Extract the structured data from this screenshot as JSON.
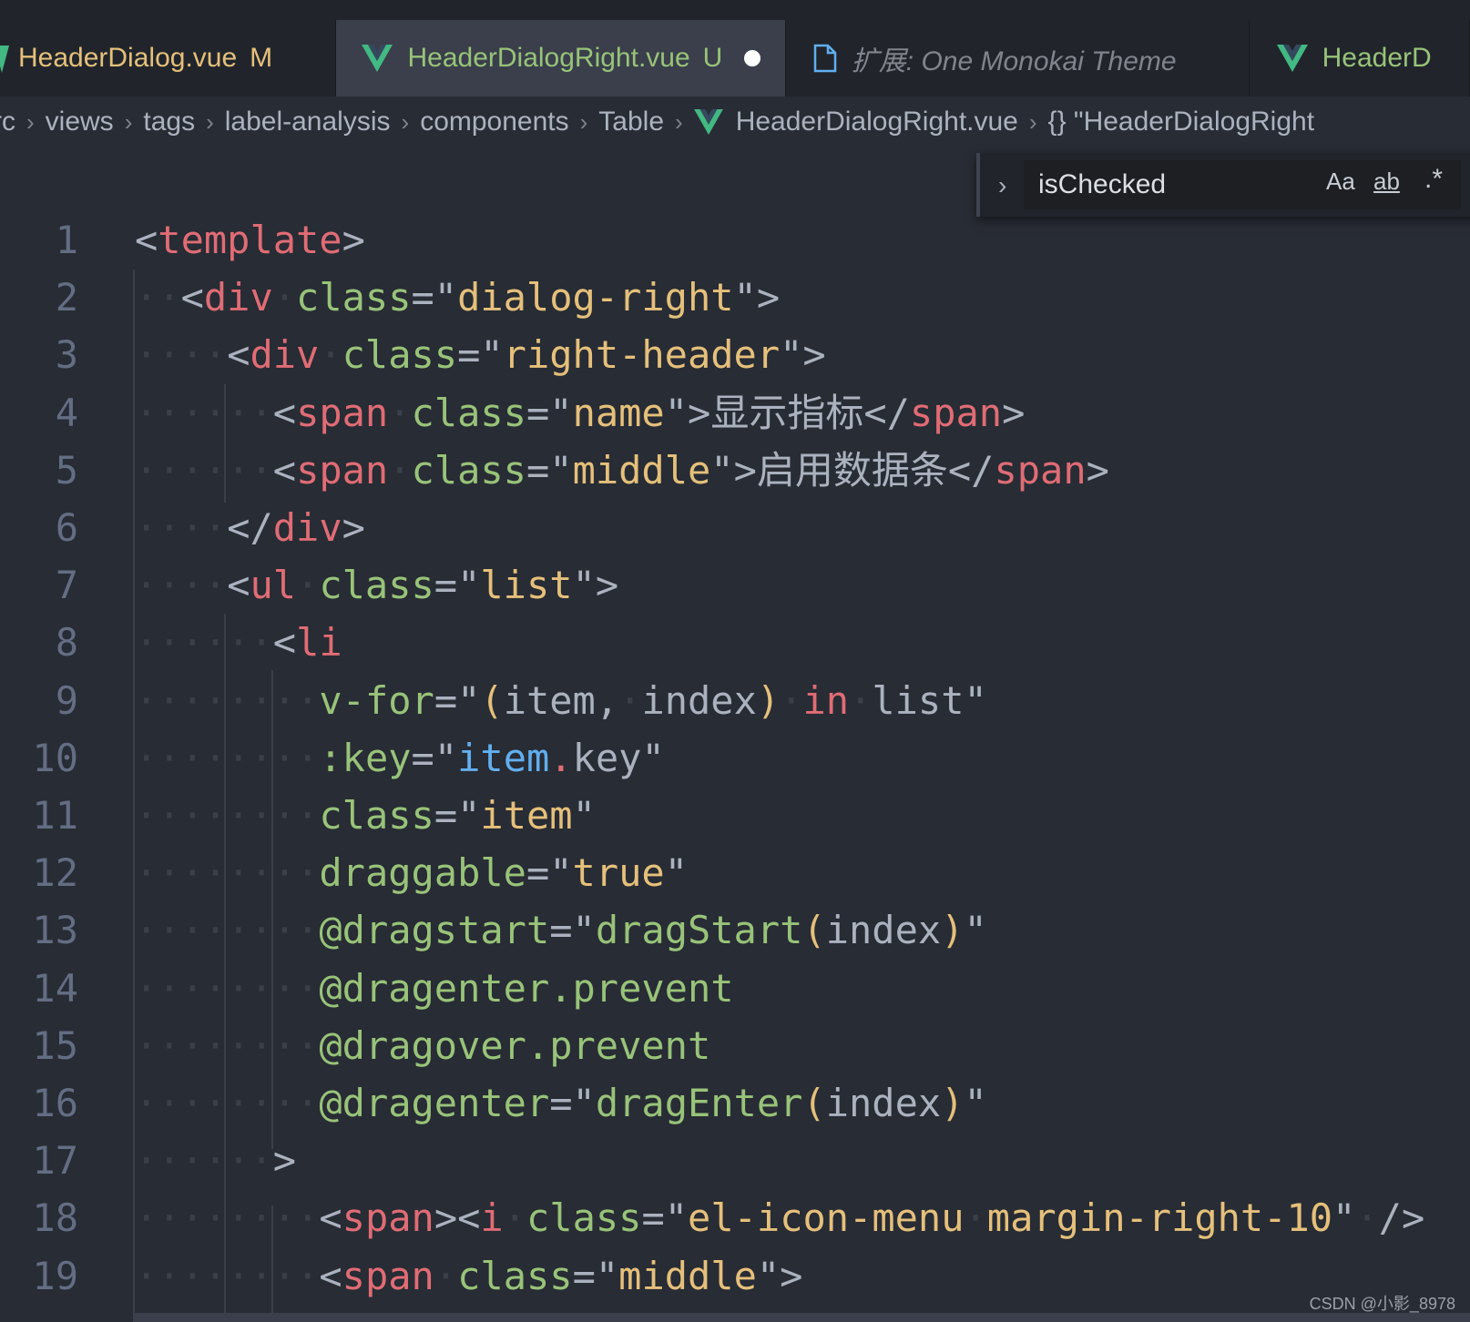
{
  "tabs": [
    {
      "label": "HeaderDialog.vue",
      "status": "M",
      "icon": "vue-icon"
    },
    {
      "label": "HeaderDialogRight.vue",
      "status": "U",
      "dirty": true,
      "icon": "vue-icon"
    },
    {
      "label": "扩展: One Monokai Theme",
      "icon": "file-icon"
    },
    {
      "label": "HeaderD",
      "icon": "vue-icon"
    }
  ],
  "breadcrumb": {
    "items": [
      "rc",
      "views",
      "tags",
      "label-analysis",
      "components",
      "Table",
      "HeaderDialogRight.vue",
      "{} \"HeaderDialogRight"
    ]
  },
  "find": {
    "query": "isChecked",
    "case_label": "Aa",
    "word_label": "ab",
    "regex_label": ".*"
  },
  "editor": {
    "lines": [
      {
        "n": "1",
        "text": "<template>"
      },
      {
        "n": "2",
        "text": "··<div·class=\"dialog-right\">"
      },
      {
        "n": "3",
        "text": "····<div·class=\"right-header\">"
      },
      {
        "n": "4",
        "text": "······<span·class=\"name\">显示指标</span>"
      },
      {
        "n": "5",
        "text": "······<span·class=\"middle\">启用数据条</span>"
      },
      {
        "n": "6",
        "text": "····</div>"
      },
      {
        "n": "7",
        "text": "····<ul·class=\"list\">"
      },
      {
        "n": "8",
        "text": "······<li"
      },
      {
        "n": "9",
        "text": "········v-for=\"(item,·index)·in·list\""
      },
      {
        "n": "10",
        "text": "········:key=\"item.key\""
      },
      {
        "n": "11",
        "text": "········class=\"item\""
      },
      {
        "n": "12",
        "text": "········draggable=\"true\""
      },
      {
        "n": "13",
        "text": "········@dragstart=\"dragStart(index)\""
      },
      {
        "n": "14",
        "text": "········@dragenter.prevent"
      },
      {
        "n": "15",
        "text": "········@dragover.prevent"
      },
      {
        "n": "16",
        "text": "········@dragenter=\"dragEnter(index)\""
      },
      {
        "n": "17",
        "text": "······>"
      },
      {
        "n": "18",
        "text": "········<span><i·class=\"el-icon-menu·margin-right-10\"·/>"
      },
      {
        "n": "19",
        "text": "········<span·class=\"middle\">"
      }
    ]
  },
  "watermark": "CSDN @小影_8978",
  "colors": {
    "background": "#282c34",
    "tag": "#e06c75",
    "attribute": "#98c379",
    "string": "#e5c07b",
    "vue_icon": "#42b883"
  }
}
